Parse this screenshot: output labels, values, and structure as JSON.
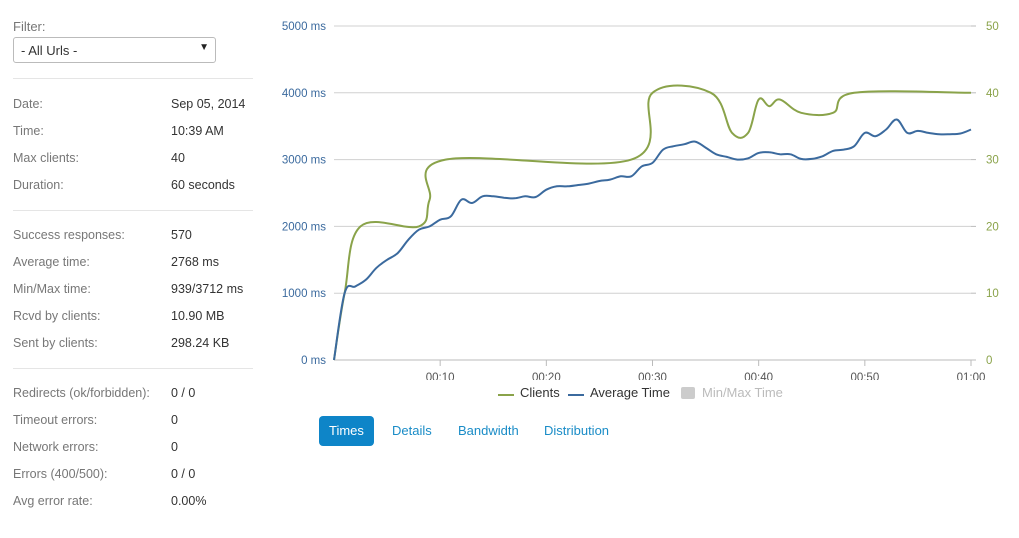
{
  "sidebar": {
    "filter_label": "Filter:",
    "filter_selected": "- All Urls -",
    "group1": [
      {
        "label": "Date:",
        "value": "Sep 05, 2014"
      },
      {
        "label": "Time:",
        "value": "10:39 AM"
      },
      {
        "label": "Max clients:",
        "value": "40"
      },
      {
        "label": "Duration:",
        "value": "60 seconds"
      }
    ],
    "group2": [
      {
        "label": "Success responses:",
        "value": "570"
      },
      {
        "label": "Average time:",
        "value": "2768 ms"
      },
      {
        "label": "Min/Max time:",
        "value": "939/3712 ms"
      },
      {
        "label": "Rcvd by clients:",
        "value": "10.90 MB"
      },
      {
        "label": "Sent by clients:",
        "value": "298.24 KB"
      }
    ],
    "group3": [
      {
        "label": "Redirects (ok/forbidden):",
        "value": "0 / 0"
      },
      {
        "label": "Timeout errors:",
        "value": "0"
      },
      {
        "label": "Network errors:",
        "value": "0"
      },
      {
        "label": "Errors (400/500):",
        "value": "0 / 0"
      },
      {
        "label": "Avg error rate:",
        "value": "0.00%"
      }
    ]
  },
  "tabs": [
    {
      "label": "Times",
      "active": true
    },
    {
      "label": "Details",
      "active": false
    },
    {
      "label": "Bandwidth",
      "active": false
    },
    {
      "label": "Distribution",
      "active": false
    }
  ],
  "colors": {
    "clients": "#8aa34a",
    "average": "#3b6a9e",
    "minmax_disabled": "#cccccc",
    "left_axis": "#3b6a9e",
    "right_axis": "#8aa34a",
    "accent": "#0e85c8"
  },
  "chart_data": {
    "type": "line",
    "x_ticks": [
      "00:10",
      "00:20",
      "00:30",
      "00:40",
      "00:50",
      "01:00"
    ],
    "x_tick_seconds": [
      10,
      20,
      30,
      40,
      50,
      60
    ],
    "xlim": [
      0,
      60
    ],
    "y_left_ticks": [
      "0 ms",
      "1000 ms",
      "2000 ms",
      "3000 ms",
      "4000 ms",
      "5000 ms"
    ],
    "y_left_values": [
      0,
      1000,
      2000,
      3000,
      4000,
      5000
    ],
    "ylim_left": [
      0,
      5000
    ],
    "y_right_ticks": [
      "0",
      "10",
      "20",
      "30",
      "40",
      "50"
    ],
    "y_right_values": [
      0,
      10,
      20,
      30,
      40,
      50
    ],
    "ylim_right": [
      0,
      50
    ],
    "grid": true,
    "legend_placement": "bottom",
    "series": [
      {
        "name": "Clients",
        "axis": "right",
        "x": [
          0,
          1,
          2.5,
          8,
          9,
          10.5,
          28,
          30,
          35.5,
          37.5,
          39,
          40,
          41,
          42,
          44,
          47,
          49,
          60
        ],
        "values": [
          0,
          10,
          20,
          20,
          24,
          30,
          30,
          40,
          40,
          34,
          34,
          39,
          38,
          39,
          37,
          37,
          40,
          40
        ]
      },
      {
        "name": "Average Time",
        "axis": "left",
        "x": [
          0,
          1,
          2,
          3,
          4,
          5,
          6,
          7,
          8,
          9,
          10,
          11,
          12,
          13,
          14,
          15,
          16,
          17,
          18,
          19,
          20,
          21,
          22,
          23,
          24,
          25,
          26,
          27,
          28,
          29,
          30,
          31,
          32,
          33,
          34,
          35,
          36,
          37,
          38,
          39,
          40,
          41,
          42,
          43,
          44,
          45,
          46,
          47,
          48,
          49,
          50,
          51,
          52,
          53,
          54,
          55,
          56,
          57,
          58,
          59,
          60
        ],
        "values": [
          0,
          1000,
          1100,
          1200,
          1380,
          1500,
          1600,
          1800,
          1950,
          2000,
          2100,
          2150,
          2400,
          2350,
          2450,
          2450,
          2430,
          2420,
          2450,
          2440,
          2550,
          2600,
          2600,
          2620,
          2640,
          2680,
          2700,
          2750,
          2750,
          2900,
          2950,
          3150,
          3200,
          3230,
          3270,
          3180,
          3080,
          3040,
          3000,
          3020,
          3100,
          3110,
          3080,
          3080,
          3010,
          3010,
          3050,
          3130,
          3150,
          3200,
          3400,
          3350,
          3450,
          3600,
          3400,
          3430,
          3400,
          3380,
          3380,
          3390,
          3450
        ]
      },
      {
        "name": "Min/Max Time",
        "axis": "left",
        "disabled": true
      }
    ]
  }
}
